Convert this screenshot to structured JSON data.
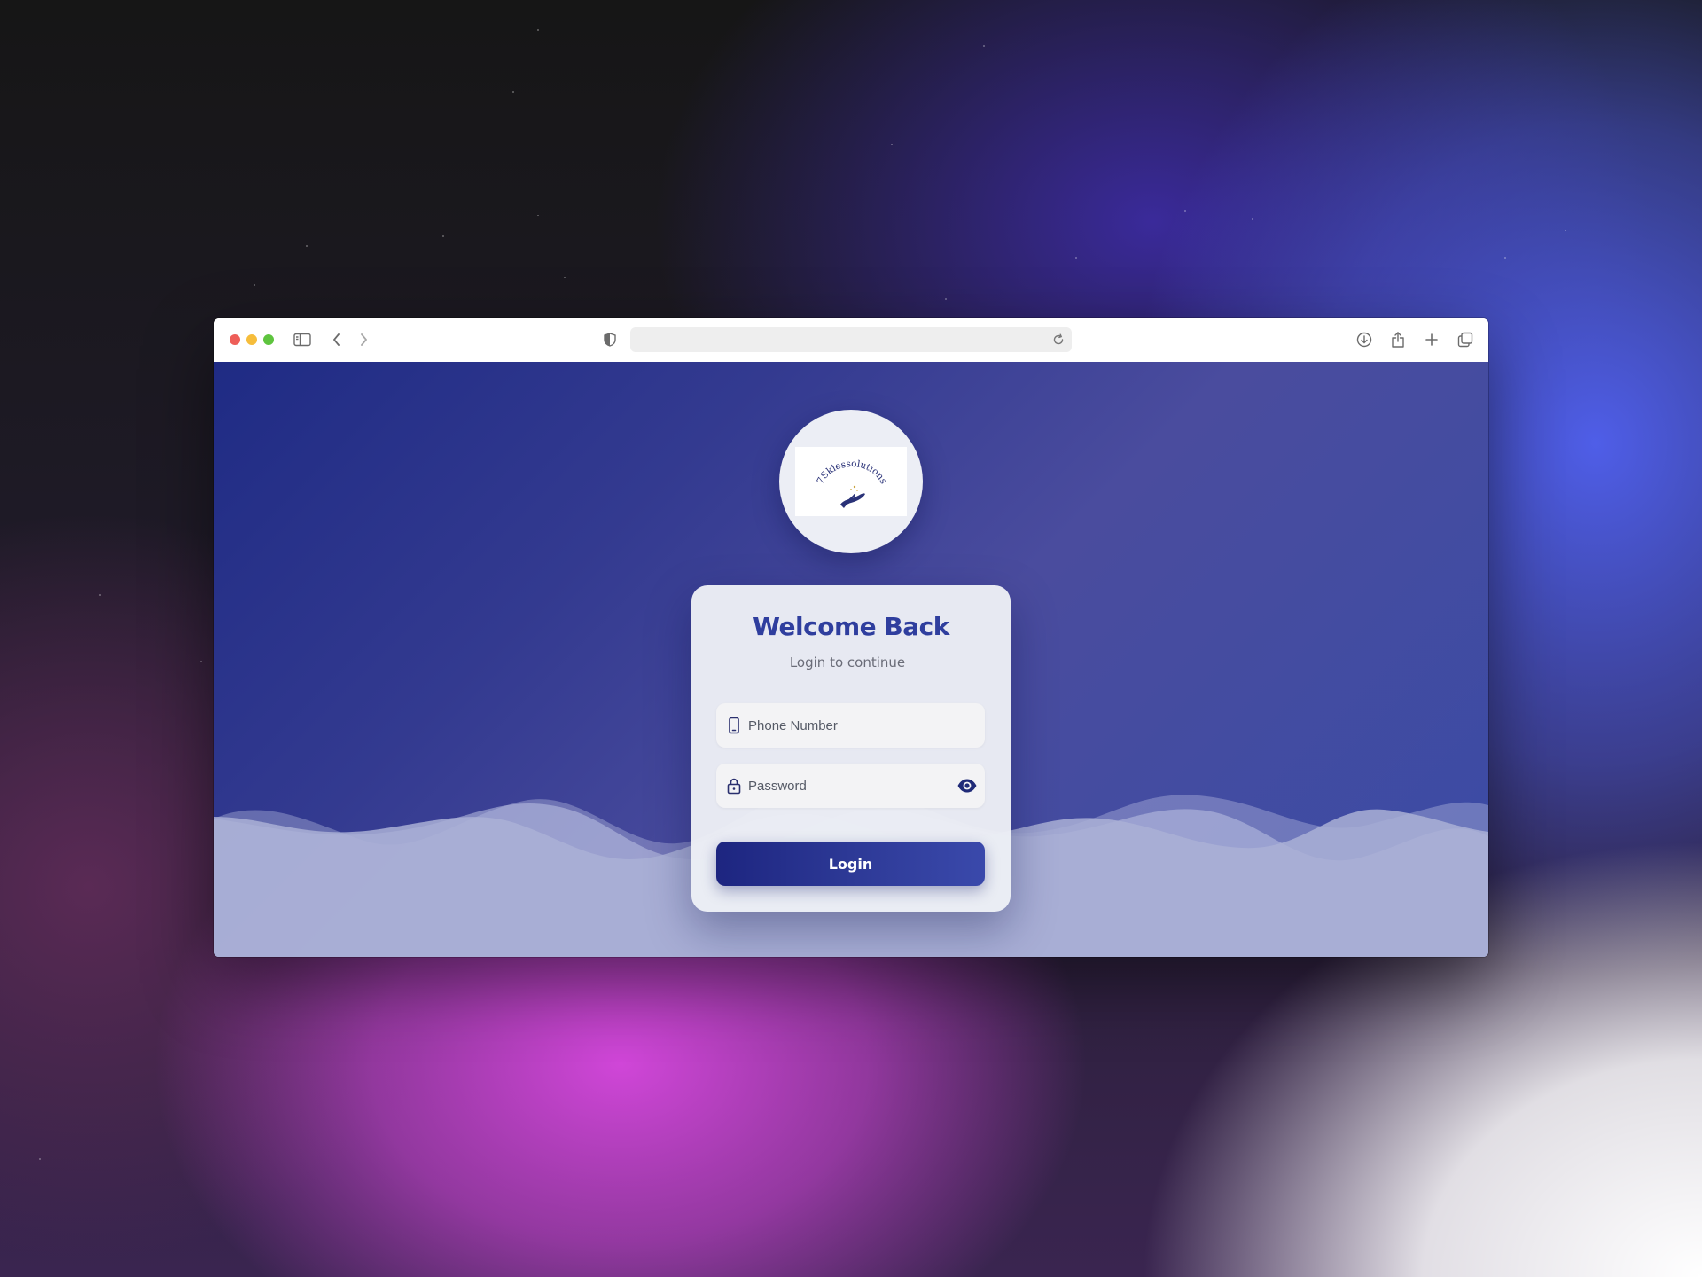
{
  "browser": {
    "address_value": "",
    "icons": [
      "sidebar-icon",
      "back-icon",
      "forward-icon",
      "privacy-shield-icon",
      "reload-icon",
      "download-icon",
      "share-icon",
      "new-tab-icon",
      "tabs-overview-icon"
    ]
  },
  "logo": {
    "text": "7Skiessolutions"
  },
  "login": {
    "title": "Welcome Back",
    "subtitle": "Login to continue",
    "phone_placeholder": "Phone Number",
    "phone_value": "",
    "password_placeholder": "Password",
    "password_value": "",
    "submit_label": "Login"
  },
  "colors": {
    "accent": "#2f3e9e",
    "button_start": "#1d2580",
    "button_end": "#3a49ab",
    "page_bg": "#3a4599"
  }
}
